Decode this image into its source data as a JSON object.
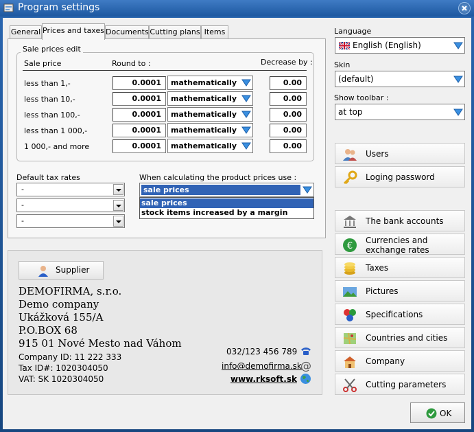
{
  "window": {
    "title": "Program settings"
  },
  "tabs": [
    {
      "label": "General"
    },
    {
      "label": "Prices and taxes"
    },
    {
      "label": "Documents"
    },
    {
      "label": "Cutting plans"
    },
    {
      "label": "Items"
    }
  ],
  "sale_prices": {
    "group_title": "Sale prices edit",
    "col_price": "Sale price",
    "col_round": "Round to :",
    "col_decrease": "Decrease by :",
    "rows": [
      {
        "label": "less than 1,-",
        "round": "0.0001",
        "method": "mathematically",
        "decrease": "0.00"
      },
      {
        "label": "less than 10,-",
        "round": "0.0001",
        "method": "mathematically",
        "decrease": "0.00"
      },
      {
        "label": "less than 100,-",
        "round": "0.0001",
        "method": "mathematically",
        "decrease": "0.00"
      },
      {
        "label": "less than 1 000,-",
        "round": "0.0001",
        "method": "mathematically",
        "decrease": "0.00"
      },
      {
        "label": "1 000,- and more",
        "round": "0.0001",
        "method": "mathematically",
        "decrease": "0.00"
      }
    ]
  },
  "tax": {
    "label": "Default tax rates",
    "values": [
      "-",
      "-",
      "-"
    ]
  },
  "calc": {
    "label": "When calculating the product prices use :",
    "selected": "sale prices",
    "options": [
      "sale prices",
      "stock items increased by a margin"
    ]
  },
  "language": {
    "label": "Language",
    "value": "English (English)"
  },
  "skin": {
    "label": "Skin",
    "value": "(default)"
  },
  "toolbar": {
    "label": "Show toolbar :",
    "value": "at top"
  },
  "side_buttons": {
    "users": "Users",
    "password": "Loging password",
    "bank": "The bank accounts",
    "currencies": "Currencies and exchange rates",
    "taxes": "Taxes",
    "pictures": "Pictures",
    "specifications": "Specifications",
    "countries": "Countries and cities",
    "company": "Company",
    "cutting": "Cutting parameters"
  },
  "supplier": {
    "button": "Supplier",
    "name": "DEMOFIRMA, s.r.o.",
    "name2": "Demo company",
    "street": "Ukážková 155/A",
    "pobox": "P.O.BOX 68",
    "city": "915 01  Nové Mesto nad Váhom",
    "company_id": "Company ID: 11 222 333",
    "tax_id": "Tax ID#: 1020304050",
    "vat": "VAT: SK 1020304050",
    "phone": "032/123 456 789",
    "email": "info@demofirma.sk",
    "web": "www.rksoft.sk"
  },
  "ok_button": "OK",
  "colors": {
    "title_bar": "#1d58a0",
    "selection": "#3163b5",
    "combo_arrow": "#3a8fe0"
  }
}
